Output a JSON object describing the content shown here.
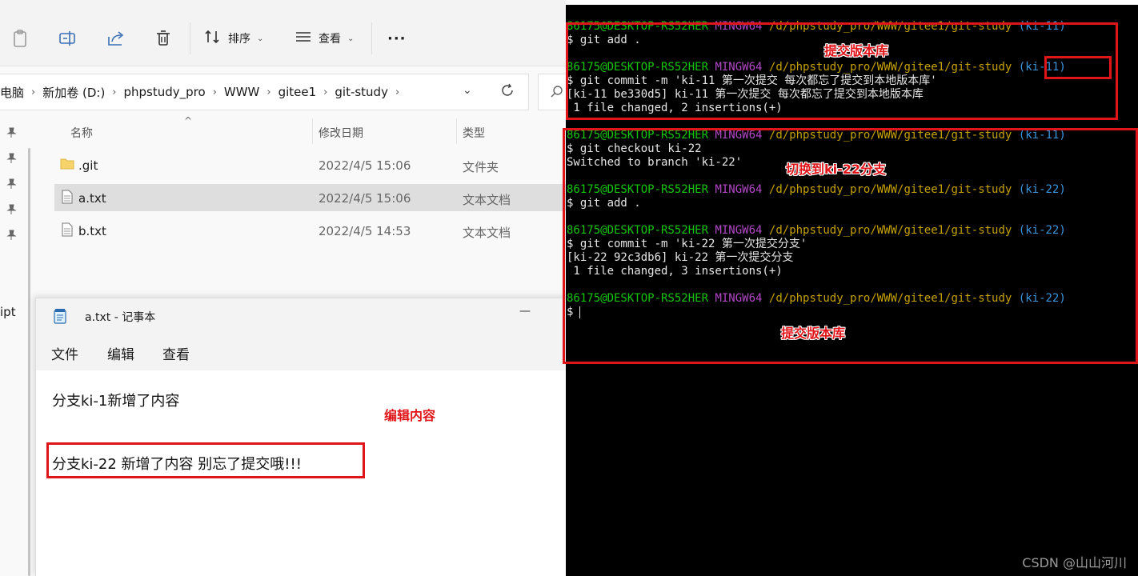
{
  "explorer": {
    "toolbar": {
      "sort_label": "排序",
      "view_label": "查看",
      "more_label": "···"
    },
    "breadcrumbs": [
      "电脑",
      "新加卷 (D:)",
      "phpstudy_pro",
      "WWW",
      "gitee1",
      "git-study"
    ],
    "nav_partial": "ipt",
    "columns": {
      "name": "名称",
      "modified": "修改日期",
      "type": "类型"
    },
    "files": [
      {
        "name": ".git",
        "modified": "2022/4/5 15:06",
        "type": "文件夹",
        "icon": "folder-icon"
      },
      {
        "name": "a.txt",
        "modified": "2022/4/5 15:06",
        "type": "文本文档",
        "icon": "text-file-icon",
        "selected": true
      },
      {
        "name": "b.txt",
        "modified": "2022/4/5 14:53",
        "type": "文本文档",
        "icon": "text-file-icon"
      }
    ]
  },
  "notepad": {
    "title": "a.txt - 记事本",
    "minimize": "—",
    "menu": [
      "文件",
      "编辑",
      "查看"
    ],
    "lines": [
      "分支ki-1新增了内容",
      "分支ki-22 新增了内容 别忘了提交哦!!!"
    ]
  },
  "terminal": {
    "prompt": {
      "user": "86175@DESKTOP-RS52HER",
      "system": "MINGW64",
      "path": "/d/phpstudy_pro/WWW/gitee1/git-study"
    },
    "lines": [
      {
        "kind": "prompt",
        "branch": "(ki-11)"
      },
      {
        "kind": "text",
        "text": "$ git add ."
      },
      {
        "kind": "blank"
      },
      {
        "kind": "prompt",
        "branch": "(ki-11)"
      },
      {
        "kind": "text",
        "text": "$ git commit -m 'ki-11 第一次提交 每次都忘了提交到本地版本库'"
      },
      {
        "kind": "text",
        "text": "[ki-11 be330d5] ki-11 第一次提交 每次都忘了提交到本地版本库"
      },
      {
        "kind": "text",
        "text": " 1 file changed, 2 insertions(+)"
      },
      {
        "kind": "blank"
      },
      {
        "kind": "prompt",
        "branch": "(ki-11)"
      },
      {
        "kind": "text",
        "text": "$ git checkout ki-22"
      },
      {
        "kind": "text",
        "text": "Switched to branch 'ki-22'"
      },
      {
        "kind": "blank"
      },
      {
        "kind": "prompt",
        "branch": "(ki-22)"
      },
      {
        "kind": "text",
        "text": "$ git add ."
      },
      {
        "kind": "blank"
      },
      {
        "kind": "prompt",
        "branch": "(ki-22)"
      },
      {
        "kind": "text",
        "text": "$ git commit -m 'ki-22 第一次提交分支'"
      },
      {
        "kind": "text",
        "text": "[ki-22 92c3db6] ki-22 第一次提交分支"
      },
      {
        "kind": "text",
        "text": " 1 file changed, 3 insertions(+)"
      },
      {
        "kind": "blank"
      },
      {
        "kind": "prompt",
        "branch": "(ki-22)"
      },
      {
        "kind": "cursor",
        "text": "$"
      }
    ]
  },
  "annotations": {
    "commit_top": "提交版本库",
    "switch_branch": "切换到ki-22分支",
    "commit_bottom": "提交版本库",
    "edit_content": "编辑内容"
  },
  "watermark": "CSDN @山山河川",
  "colors": {
    "annotation_red": "#e0151a",
    "terminal_bg": "#000000",
    "prompt_user": "#16c60c",
    "prompt_system": "#b148c6",
    "prompt_path": "#c4a000",
    "prompt_branch": "#3a96dd"
  }
}
